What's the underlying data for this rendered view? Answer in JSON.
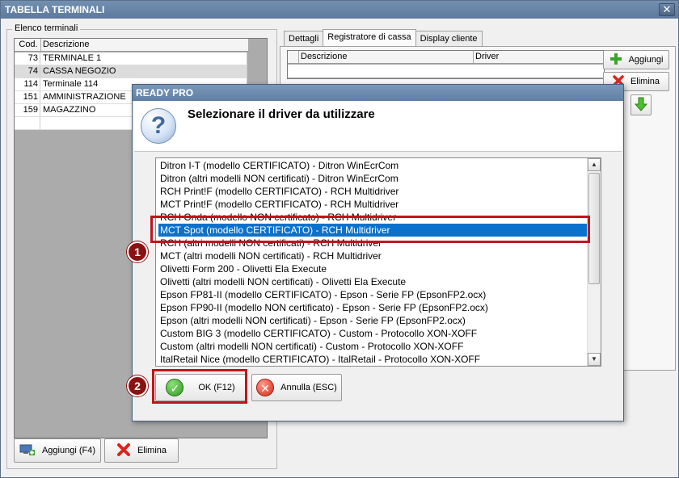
{
  "window": {
    "title": "TABELLA TERMINALI",
    "close_label": "✕"
  },
  "terminals": {
    "group_label": "Elenco terminali",
    "col_cod": "Cod.",
    "col_desc": "Descrizione",
    "rows": [
      {
        "cod": "73",
        "desc": "TERMINALE 1"
      },
      {
        "cod": "74",
        "desc": "CASSA NEGOZIO"
      },
      {
        "cod": "114",
        "desc": "Terminale 114"
      },
      {
        "cod": "151",
        "desc": "AMMINISTRAZIONE"
      },
      {
        "cod": "159",
        "desc": "MAGAZZINO"
      }
    ],
    "add_label": "Aggiungi (F4)",
    "delete_label": "Elimina"
  },
  "tabs": [
    {
      "label": "Dettagli"
    },
    {
      "label": "Registratore di cassa"
    },
    {
      "label": "Display cliente"
    }
  ],
  "cash_grid": {
    "col_desc": "Descrizione",
    "col_driver": "Driver"
  },
  "side_buttons": {
    "add_label": "Aggiungi",
    "delete_label": "Elimina"
  },
  "dialog": {
    "title": "READY PRO",
    "heading": "Selezionare il driver da utilizzare",
    "items": [
      "Ditron I-T (modello CERTIFICATO) - Ditron WinEcrCom",
      "Ditron (altri modelli NON certificati) - Ditron WinEcrCom",
      "RCH Print!F (modello CERTIFICATO) - RCH Multidriver",
      "MCT Print!F (modello CERTIFICATO) - RCH Multidriver",
      "RCH Onda (modello NON certificato) - RCH Multidriver",
      "MCT Spot (modello CERTIFICATO) - RCH Multidriver",
      "RCH (altri modelli NON certificati) - RCH Multidriver",
      "MCT (altri modelli NON certificati) - RCH Multidriver",
      "Olivetti Form 200 - Olivetti Ela Execute",
      "Olivetti (altri modelli NON certificati) - Olivetti Ela Execute",
      "Epson FP81-II (modello CERTIFICATO) - Epson - Serie FP (EpsonFP2.ocx)",
      "Epson FP90-II (modello NON certificato) - Epson - Serie FP (EpsonFP2.ocx)",
      "Epson (altri modelli NON certificati) - Epson - Serie FP (EpsonFP2.ocx)",
      "Custom BIG 3 (modello CERTIFICATO) - Custom - Protocollo XON-XOFF",
      "Custom (altri modelli NON certificati) - Custom - Protocollo XON-XOFF",
      "ItalRetail Nice (modello CERTIFICATO) - ItalRetail - Protocollo XON-XOFF"
    ],
    "selected_item": "MCT Spot (modello CERTIFICATO) - RCH Multidriver",
    "ok_label": "OK (F12)",
    "cancel_label": "Annulla (ESC)"
  },
  "callouts": {
    "one": "1",
    "two": "2"
  },
  "colors": {
    "selection": "#0a72cc",
    "callout": "#c0151c",
    "titlebar": "#5d7a9c"
  }
}
